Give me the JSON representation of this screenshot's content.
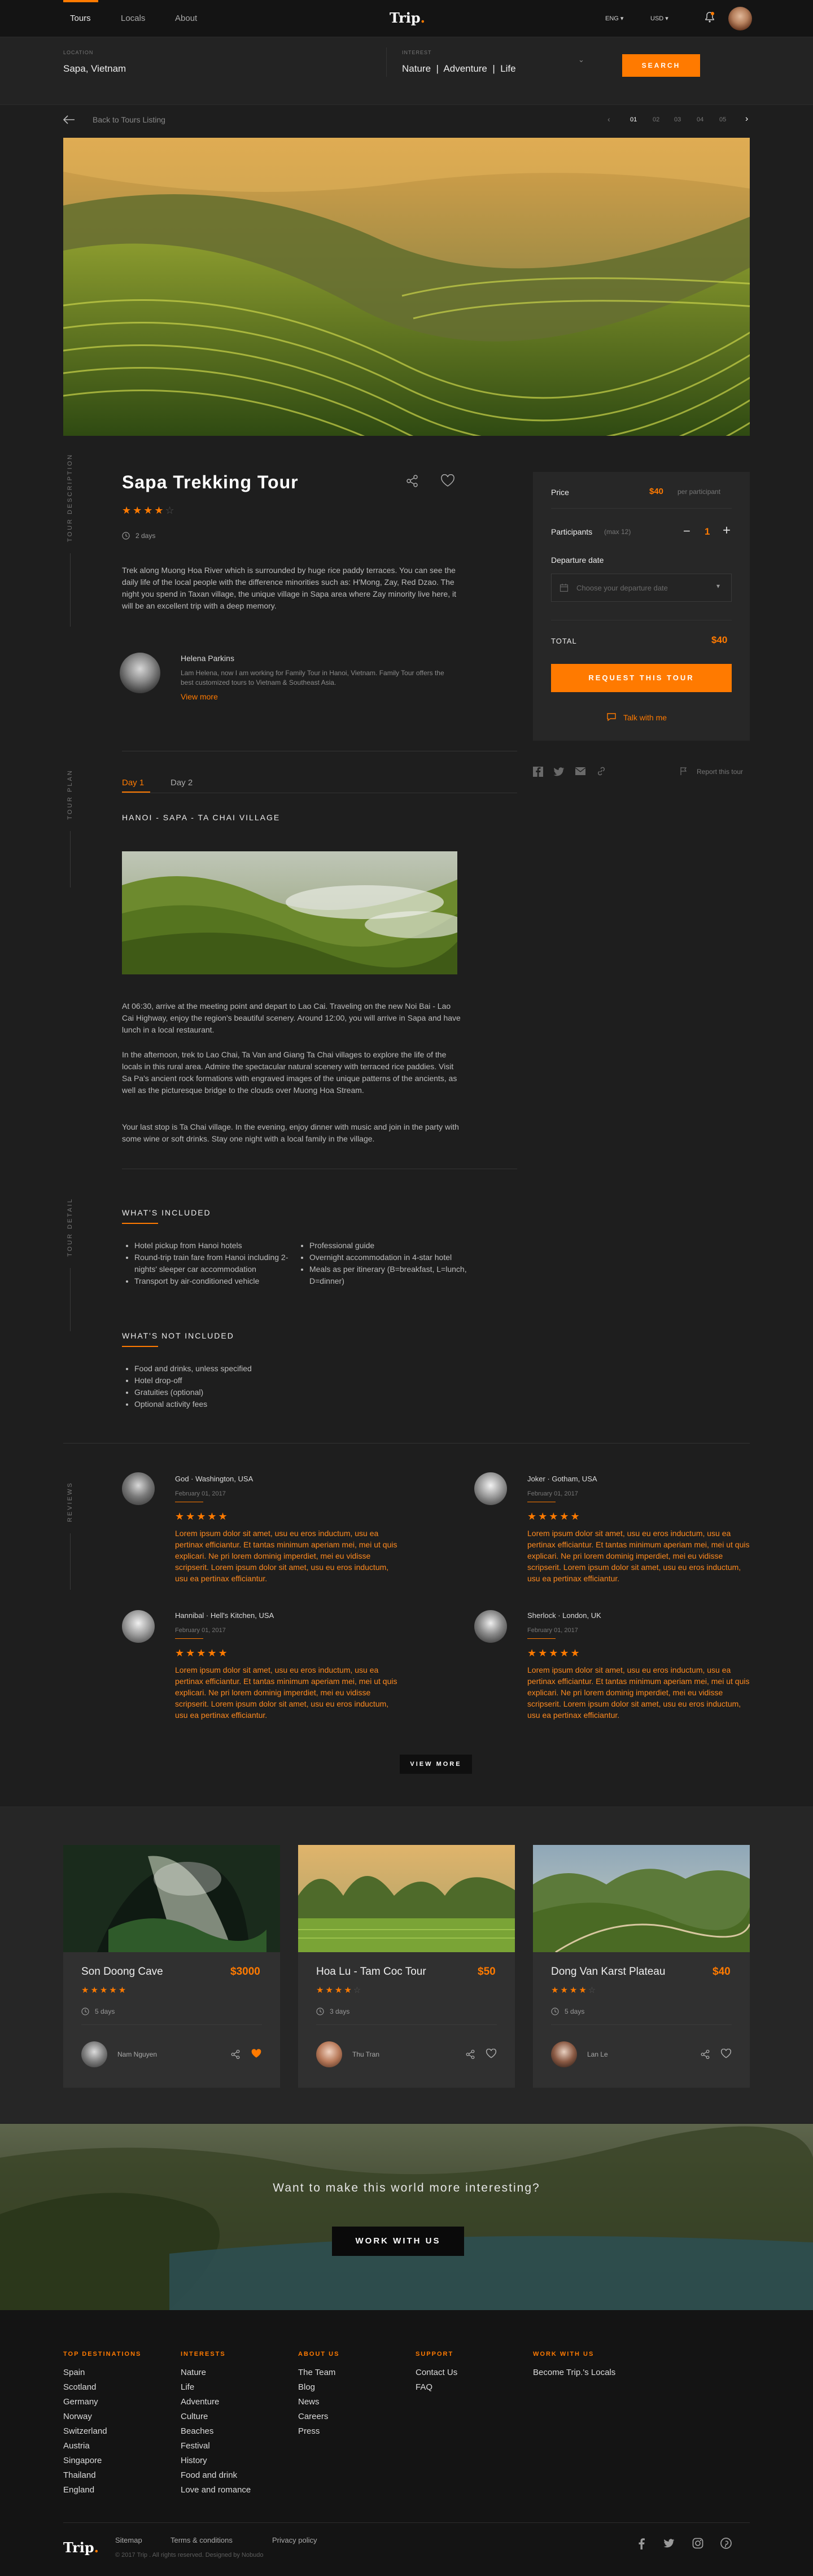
{
  "nav": {
    "links": [
      "Tours",
      "Locals",
      "About"
    ],
    "logo": "Trip",
    "lang": "ENG",
    "currency": "USD"
  },
  "search": {
    "location_label": "LOCATION",
    "location_value": "Sapa, Vietnam",
    "interest_label": "INTEREST",
    "interest_value": "Nature  |  Adventure  |  Life",
    "button": "SEARCH"
  },
  "pager": {
    "back": "Back to Tours Listing",
    "pages": [
      "01",
      "02",
      "03",
      "04",
      "05"
    ]
  },
  "tour": {
    "side_description": "TOUR DESCRIPTION",
    "title": "Sapa Trekking Tour",
    "duration": "2 days",
    "description": "Trek along Muong Hoa River which is surrounded by huge rice paddy terraces. You can see the daily life of the local people with the difference minorities such as: H'Mong, Zay, Red Dzao. The night you spend in Taxan village, the unique village in Sapa area where Zay minority live here, it will be an excellent trip with a deep memory.",
    "host_name": "Helena Parkins",
    "host_bio": "Lam Helena, now I am working for Family Tour in Hanoi, Vietnam. Family Tour offers the best customized tours to Vietnam & Southeast Asia.",
    "view_more": "View more"
  },
  "booking": {
    "price_label": "Price",
    "price_value": "$40",
    "price_unit": "per participant",
    "participants_label": "Participants",
    "participants_note": "(max 12)",
    "participants_value": "1",
    "departure_label": "Departure date",
    "departure_placeholder": "Choose your departure date",
    "total_label": "TOTAL",
    "total_value": "$40",
    "request_button": "REQUEST THIS TOUR",
    "talk": "Talk with me",
    "report": "Report this tour"
  },
  "plan": {
    "side_label": "TOUR PLAN",
    "tabs": [
      "Day 1",
      "Day 2"
    ],
    "route": "HANOI - SAPA - TA CHAI VILLAGE",
    "p1": "At 06:30, arrive at the meeting point and depart to Lao Cai. Traveling on the new Noi Bai - Lao Cai Highway, enjoy the region's beautiful scenery. Around 12:00, you will arrive in Sapa and have lunch in a local restaurant.",
    "p2": "In the afternoon, trek to Lao Chai, Ta Van and Giang Ta Chai villages to explore the life of the locals in this rural area. Admire the spectacular natural scenery with terraced rice paddies. Visit Sa Pa's ancient rock formations with engraved images of the unique patterns of the ancients, as well as the picturesque bridge to the clouds over Muong Hoa Stream.",
    "p3": "Your last stop is Ta Chai village. In the evening, enjoy dinner with music and join in the party with some wine or soft drinks. Stay one night with a local family in the village."
  },
  "detail": {
    "side_label": "TOUR DETAIL",
    "included_title": "WHAT'S INCLUDED",
    "included_left": [
      "Hotel pickup from Hanoi hotels",
      "Round-trip train fare from Hanoi including 2-nights' sleeper car accommodation",
      "Transport by air-conditioned vehicle"
    ],
    "included_right": [
      "Professional guide",
      "Overnight accommodation in 4-star hotel",
      "Meals as per itinerary (B=breakfast, L=lunch, D=dinner)"
    ],
    "not_included_title": "WHAT'S NOT INCLUDED",
    "not_included": [
      "Food and drinks, unless specified",
      "Hotel drop-off",
      "Gratuities (optional)",
      "Optional activity fees"
    ]
  },
  "reviews": {
    "side_label": "REVIEWS",
    "items": [
      {
        "name": "God · Washington, USA",
        "date": "February 01, 2017",
        "text": "Lorem ipsum dolor sit amet, usu eu eros inductum, usu ea pertinax efficiantur. Et tantas minimum aperiam mei, mei ut quis explicari. Ne pri lorem dominig imperdiet, mei eu vidisse scripserit. Lorem ipsum dolor sit amet, usu eu eros inductum, usu ea pertinax efficiantur."
      },
      {
        "name": "Joker · Gotham, USA",
        "date": "February 01, 2017",
        "text": "Lorem ipsum dolor sit amet, usu eu eros inductum, usu ea pertinax efficiantur. Et tantas minimum aperiam mei, mei ut quis explicari. Ne pri lorem dominig imperdiet, mei eu vidisse scripserit. Lorem ipsum dolor sit amet, usu eu eros inductum, usu ea pertinax efficiantur."
      },
      {
        "name": "Hannibal · Hell's Kitchen, USA",
        "date": "February 01, 2017",
        "text": "Lorem ipsum dolor sit amet, usu eu eros inductum, usu ea pertinax efficiantur. Et tantas minimum aperiam mei, mei ut quis explicari. Ne pri lorem dominig imperdiet, mei eu vidisse scripserit. Lorem ipsum dolor sit amet, usu eu eros inductum, usu ea pertinax efficiantur."
      },
      {
        "name": "Sherlock · London, UK",
        "date": "February 01, 2017",
        "text": "Lorem ipsum dolor sit amet, usu eu eros inductum, usu ea pertinax efficiantur. Et tantas minimum aperiam mei, mei ut quis explicari. Ne pri lorem dominig imperdiet, mei eu vidisse scripserit. Lorem ipsum dolor sit amet, usu eu eros inductum, usu ea pertinax efficiantur."
      }
    ],
    "view_more": "VIEW MORE"
  },
  "cards": [
    {
      "title": "Son Doong Cave",
      "price": "$3000",
      "stars": 5,
      "duration": "5 days",
      "host": "Nam Nguyen",
      "liked": true
    },
    {
      "title": "Hoa Lu - Tam Coc Tour",
      "price": "$50",
      "stars": 4,
      "duration": "3 days",
      "host": "Thu Tran",
      "liked": false
    },
    {
      "title": "Dong Van Karst Plateau",
      "price": "$40",
      "stars": 4,
      "duration": "5 days",
      "host": "Lan Le",
      "liked": false
    }
  ],
  "cta": {
    "text": "Want to make this world more interesting?",
    "button": "WORK WITH US"
  },
  "footer": {
    "cols": [
      {
        "title": "TOP DESTINATIONS",
        "links": [
          "Spain",
          "Scotland",
          "Germany",
          "Norway",
          "Switzerland",
          "Austria",
          "Singapore",
          "Thailand",
          "England"
        ]
      },
      {
        "title": "INTERESTS",
        "links": [
          "Nature",
          "Life",
          "Adventure",
          "Culture",
          "Beaches",
          "Festival",
          "History",
          "Food and drink",
          "Love and romance"
        ]
      },
      {
        "title": "ABOUT US",
        "links": [
          "The Team",
          "Blog",
          "News",
          "Careers",
          "Press"
        ]
      },
      {
        "title": "SUPPORT",
        "links": [
          "Contact Us",
          "FAQ"
        ]
      },
      {
        "title": "WORK WITH US",
        "links": [
          "Become Trip.'s Locals"
        ]
      }
    ],
    "logo": "Trip",
    "bottom_links": [
      "Sitemap",
      "Terms & conditions",
      "Privacy policy"
    ],
    "copyright": "© 2017 Trip . All rights reserved. Designed by Nobudo"
  },
  "colors": {
    "accent": "#ff7a00",
    "bg": "#1e1e1e",
    "panel": "#272727"
  }
}
